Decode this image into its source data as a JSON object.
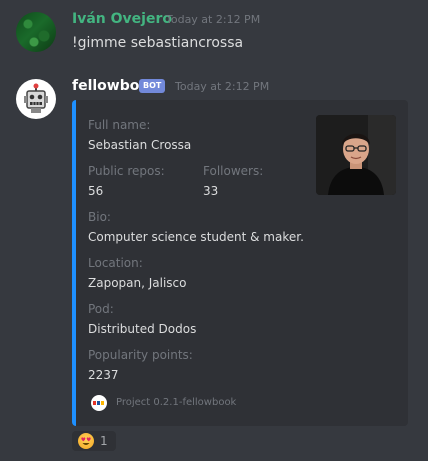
{
  "messages": [
    {
      "username": "Iván Ovejero",
      "timestamp": "Today at 2:12 PM",
      "content": "!gimme sebastiancrossa",
      "username_color": "#43b581"
    },
    {
      "username": "fellowbot",
      "bot_tag": "BOT",
      "timestamp": "Today at 2:12 PM",
      "username_color": "#ffffff",
      "embed": {
        "accent_color": "#1e90ff",
        "fields": {
          "full_name": {
            "name": "Full name:",
            "value": "Sebastian Crossa"
          },
          "public_repos": {
            "name": "Public repos:",
            "value": "56"
          },
          "followers": {
            "name": "Followers:",
            "value": "33"
          },
          "bio": {
            "name": "Bio:",
            "value": "Computer science student & maker."
          },
          "location": {
            "name": "Location:",
            "value": "Zapopan, Jalisco"
          },
          "pod": {
            "name": "Pod:",
            "value": "Distributed Dodos"
          },
          "popularity": {
            "name": "Popularity points:",
            "value": "2237"
          }
        },
        "thumbnail_icon": "profile-photo",
        "footer": {
          "icon": "mlh-logo-icon",
          "text": "Project 0.2.1-fellowbook"
        }
      },
      "reactions": [
        {
          "emoji": "heart-eyes-emoji",
          "count": "1"
        }
      ]
    }
  ]
}
